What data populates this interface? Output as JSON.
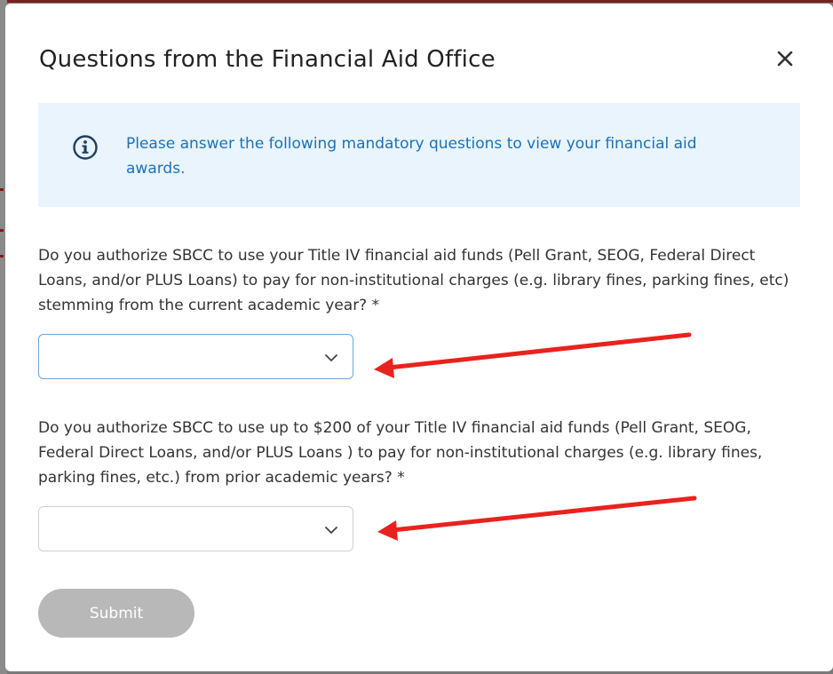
{
  "modal": {
    "title": "Questions from the Financial Aid Office",
    "info_text": "Please answer the following mandatory questions to view your financial aid awards."
  },
  "questions": [
    {
      "text": "Do you authorize SBCC to use your Title IV financial aid funds (Pell Grant, SEOG, Federal Direct Loans, and/or PLUS Loans) to pay for non-institutional charges (e.g. library fines, parking fines, etc) stemming from the current academic year? *",
      "selected": ""
    },
    {
      "text": "Do you authorize SBCC to use up to $200 of your Title IV financial aid funds (Pell Grant, SEOG, Federal Direct Loans, and/or PLUS Loans ) to pay for non-institutional charges (e.g. library fines, parking fines, etc.) from prior academic years? *",
      "selected": ""
    }
  ],
  "submit_label": "Submit",
  "icons": {
    "info": "info-circle-icon",
    "close": "close-icon",
    "dropdown": "chevron-down-icon"
  },
  "colors": {
    "info_bg": "#e9f4fc",
    "info_text": "#1b72b8",
    "disabled_button": "#b8b8b8",
    "annotation": "#e8231e"
  }
}
